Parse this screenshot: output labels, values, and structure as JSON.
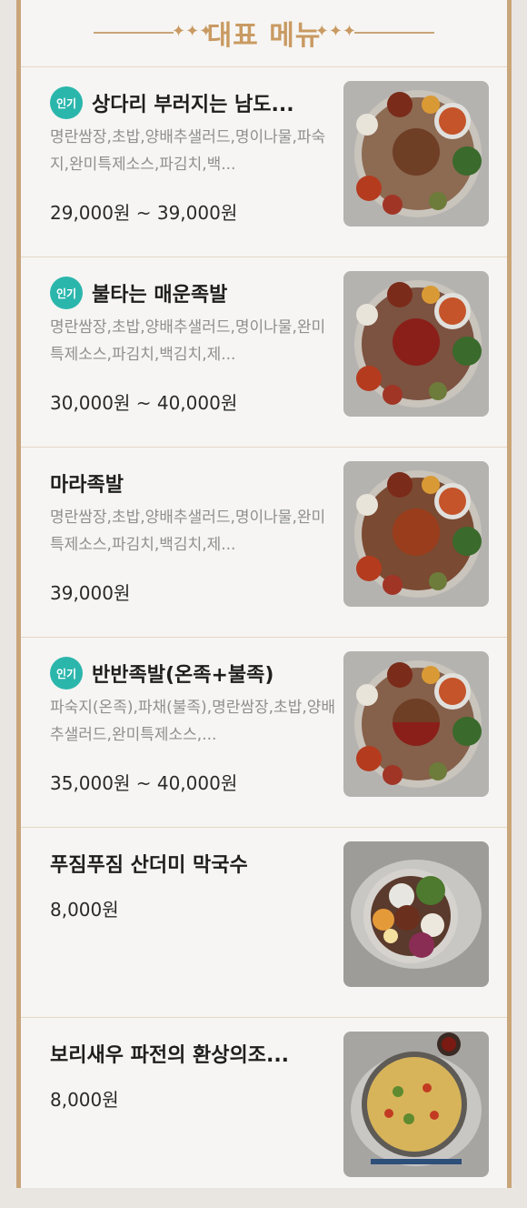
{
  "section_title": "대표 메뉴",
  "badge_label": "인기",
  "menu": [
    {
      "name": "상다리 부러지는 남도...",
      "popular": true,
      "desc": "명란쌈장,초밥,양배추샐러드,명이나물,파숙지,완미특제소스,파김치,백...",
      "price": "29,000원 ~ 39,000원"
    },
    {
      "name": "불타는 매운족발",
      "popular": true,
      "desc": "명란쌈장,초밥,양배추샐러드,명이나물,완미특제소스,파김치,백김치,제...",
      "price": "30,000원 ~ 40,000원"
    },
    {
      "name": "마라족발",
      "popular": false,
      "desc": "명란쌈장,초밥,양배추샐러드,명이나물,완미특제소스,파김치,백김치,제...",
      "price": "39,000원"
    },
    {
      "name": "반반족발(온족+불족)",
      "popular": true,
      "desc": "파숙지(온족),파채(불족),명란쌈장,초밥,양배추샐러드,완미특제소스,...",
      "price": "35,000원 ~ 40,000원"
    },
    {
      "name": "푸짐푸짐 산더미 막국수",
      "popular": false,
      "desc": "",
      "price": "8,000원"
    },
    {
      "name": "보리새우 파전의 환상의조...",
      "popular": false,
      "desc": "",
      "price": "8,000원"
    }
  ]
}
